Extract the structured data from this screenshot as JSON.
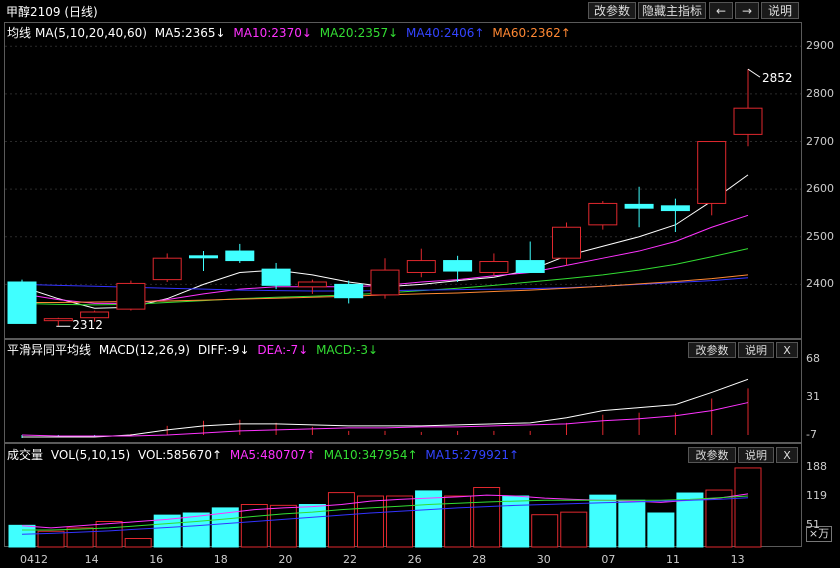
{
  "title": "甲醇2109 (日线)",
  "toolbar": {
    "modify": "改参数",
    "hide_main": "隐藏主指标",
    "left": "←",
    "right": "→",
    "help": "说明"
  },
  "colors": {
    "up": "#e0282e",
    "down": "#40ffff",
    "ma5": "#ffffff",
    "ma10": "#ff33ff",
    "ma20": "#33dd33",
    "ma40": "#3333ff",
    "ma60": "#ff8833"
  },
  "main_panel": {
    "legend": {
      "name": "均线",
      "ma": "MA(5,10,20,40,60)",
      "ma5": "MA5:2365↓",
      "ma10": "MA10:2370↓",
      "ma20": "MA20:2357↓",
      "ma40": "MA40:2406↑",
      "ma60": "MA60:2362↑"
    },
    "annotations": {
      "high": "2852",
      "low": "2312"
    }
  },
  "macd_panel": {
    "legend": {
      "name": "平滑异同平均线",
      "params": "MACD(12,26,9)",
      "diff": "DIFF:-9↓",
      "dea": "DEA:-7↓",
      "macd": "MACD:-3↓"
    },
    "buttons": {
      "modify": "改参数",
      "help": "说明",
      "close": "X"
    }
  },
  "vol_panel": {
    "legend": {
      "name": "成交量",
      "params": "VOL(5,10,15)",
      "vol": "VOL:585670↑",
      "ma5": "MA5:480707↑",
      "ma10": "MA10:347954↑",
      "ma15": "MA15:279921↑"
    },
    "buttons": {
      "modify": "改参数",
      "help": "说明",
      "close": "X"
    },
    "unit": "×万"
  },
  "chart_data": [
    {
      "type": "candlestick",
      "title": "甲醇2109 (日线)",
      "y_ticks": [
        2400,
        2500,
        2600,
        2700,
        2800,
        2900
      ],
      "ylim": [
        2300,
        2930
      ],
      "x_ticks": [
        "0412",
        "14",
        "16",
        "18",
        "20",
        "22",
        "26",
        "28",
        "30",
        "07",
        "11",
        "13"
      ],
      "candles": [
        {
          "o": 2405,
          "h": 2410,
          "l": 2318,
          "c": 2318
        },
        {
          "o": 2325,
          "h": 2330,
          "l": 2312,
          "c": 2328
        },
        {
          "o": 2330,
          "h": 2345,
          "l": 2322,
          "c": 2342
        },
        {
          "o": 2348,
          "h": 2408,
          "l": 2345,
          "c": 2402
        },
        {
          "o": 2410,
          "h": 2465,
          "l": 2405,
          "c": 2455
        },
        {
          "o": 2460,
          "h": 2470,
          "l": 2428,
          "c": 2458
        },
        {
          "o": 2470,
          "h": 2485,
          "l": 2445,
          "c": 2450
        },
        {
          "o": 2432,
          "h": 2445,
          "l": 2390,
          "c": 2398
        },
        {
          "o": 2395,
          "h": 2410,
          "l": 2380,
          "c": 2405
        },
        {
          "o": 2400,
          "h": 2408,
          "l": 2360,
          "c": 2372
        },
        {
          "o": 2378,
          "h": 2455,
          "l": 2370,
          "c": 2430
        },
        {
          "o": 2425,
          "h": 2475,
          "l": 2415,
          "c": 2450
        },
        {
          "o": 2450,
          "h": 2460,
          "l": 2405,
          "c": 2428
        },
        {
          "o": 2425,
          "h": 2465,
          "l": 2418,
          "c": 2448
        },
        {
          "o": 2450,
          "h": 2490,
          "l": 2430,
          "c": 2425
        },
        {
          "o": 2455,
          "h": 2530,
          "l": 2440,
          "c": 2520
        },
        {
          "o": 2525,
          "h": 2575,
          "l": 2515,
          "c": 2570
        },
        {
          "o": 2568,
          "h": 2605,
          "l": 2520,
          "c": 2560
        },
        {
          "o": 2565,
          "h": 2580,
          "l": 2510,
          "c": 2555
        },
        {
          "o": 2570,
          "h": 2700,
          "l": 2545,
          "c": 2700
        },
        {
          "o": 2715,
          "h": 2852,
          "l": 2690,
          "c": 2770
        }
      ],
      "ma_series": [
        {
          "name": "MA5",
          "values": [
            2395,
            2370,
            2350,
            2352,
            2370,
            2400,
            2425,
            2430,
            2420,
            2405,
            2395,
            2400,
            2408,
            2415,
            2430,
            2460,
            2480,
            2500,
            2525,
            2575,
            2630
          ]
        },
        {
          "name": "MA10",
          "values": [
            2380,
            2368,
            2360,
            2360,
            2368,
            2380,
            2390,
            2395,
            2395,
            2395,
            2398,
            2405,
            2410,
            2418,
            2425,
            2440,
            2455,
            2470,
            2490,
            2520,
            2545
          ]
        },
        {
          "name": "MA20",
          "values": [
            2360,
            2358,
            2357,
            2358,
            2362,
            2366,
            2370,
            2373,
            2375,
            2378,
            2382,
            2387,
            2392,
            2398,
            2405,
            2412,
            2420,
            2430,
            2442,
            2458,
            2475
          ]
        },
        {
          "name": "MA40",
          "values": [
            2400,
            2398,
            2396,
            2394,
            2392,
            2390,
            2388,
            2387,
            2386,
            2386,
            2387,
            2388,
            2389,
            2390,
            2391,
            2393,
            2396,
            2400,
            2404,
            2408,
            2414
          ]
        },
        {
          "name": "MA60",
          "values": [
            2362,
            2362,
            2363,
            2364,
            2365,
            2367,
            2369,
            2371,
            2373,
            2375,
            2378,
            2380,
            2382,
            2385,
            2388,
            2392,
            2396,
            2401,
            2406,
            2412,
            2420
          ]
        }
      ]
    },
    {
      "type": "bar",
      "title": "MACD(12,26,9)",
      "y_ticks": [
        -7,
        31,
        68
      ],
      "ylim": [
        -10,
        72
      ],
      "series": [
        {
          "name": "DIFF",
          "values": [
            -9,
            -9,
            -9,
            -7,
            -2,
            2,
            4,
            4,
            3,
            2,
            2,
            2,
            3,
            4,
            5,
            10,
            17,
            20,
            23,
            35,
            48
          ]
        },
        {
          "name": "DEA",
          "values": [
            -7,
            -8,
            -8,
            -8,
            -7,
            -5,
            -3,
            -2,
            -1,
            0,
            0,
            1,
            1,
            2,
            3,
            4,
            7,
            9,
            12,
            17,
            25
          ]
        },
        {
          "name": "MACD",
          "values": [
            -3,
            -2,
            -2,
            1,
            9,
            14,
            15,
            12,
            8,
            4,
            4,
            3,
            4,
            4,
            4,
            12,
            20,
            22,
            22,
            36,
            46
          ]
        }
      ]
    },
    {
      "type": "bar",
      "title": "VOL(5,10,15)",
      "y_ticks": [
        51,
        119,
        188
      ],
      "ylim": [
        0,
        200
      ],
      "values": [
        51,
        37,
        45,
        60,
        20,
        75,
        80,
        92,
        100,
        98,
        100,
        128,
        120,
        120,
        132,
        120,
        140,
        120,
        76,
        82,
        122,
        110,
        80,
        127,
        134,
        186
      ],
      "up_flags": [
        false,
        true,
        true,
        true,
        true,
        false,
        false,
        false,
        true,
        true,
        false,
        true,
        true,
        true,
        false,
        true,
        true,
        false,
        true,
        true,
        false,
        false,
        false,
        false,
        true,
        true
      ],
      "series": [
        {
          "name": "MA5",
          "values": [
            50,
            45,
            50,
            55,
            60,
            65,
            72,
            80,
            88,
            92,
            95,
            100,
            108,
            112,
            115,
            118,
            122,
            120,
            115,
            112,
            110,
            108,
            105,
            110,
            115,
            125
          ]
        },
        {
          "name": "MA10",
          "values": [
            40,
            40,
            42,
            45,
            50,
            55,
            60,
            66,
            72,
            78,
            82,
            88,
            92,
            96,
            100,
            103,
            106,
            108,
            110,
            110,
            110,
            110,
            110,
            112,
            116,
            120
          ]
        },
        {
          "name": "MA15",
          "values": [
            30,
            32,
            35,
            38,
            42,
            46,
            50,
            55,
            60,
            65,
            70,
            75,
            80,
            84,
            88,
            92,
            95,
            98,
            100,
            102,
            104,
            106,
            108,
            110,
            112,
            116
          ]
        }
      ]
    }
  ]
}
